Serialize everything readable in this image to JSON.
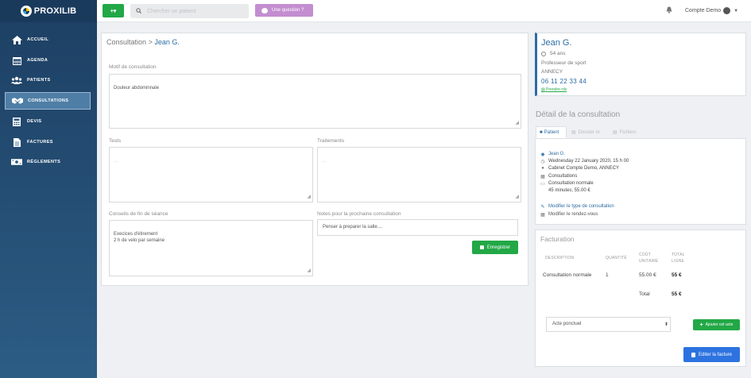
{
  "app": {
    "name": "PROXILIB"
  },
  "sidebar": {
    "items": [
      {
        "label": "ACCUEIL",
        "icon": "home-icon"
      },
      {
        "label": "AGENDA",
        "icon": "calendar-icon"
      },
      {
        "label": "PATIENTS",
        "icon": "users-icon"
      },
      {
        "label": "CONSULTATIONS",
        "icon": "handshake-icon",
        "active": true
      },
      {
        "label": "DEVIS",
        "icon": "calculator-icon"
      },
      {
        "label": "FACTURES",
        "icon": "document-icon"
      },
      {
        "label": "RÈGLEMENTS",
        "icon": "money-icon"
      }
    ]
  },
  "topbar": {
    "add_label": "+▾",
    "search_placeholder": "Chercher un patient",
    "question_label": "Une question ?",
    "account_label": "Compte Demo"
  },
  "breadcrumb": {
    "section": "Consultation",
    "separator": ">",
    "patient": "Jean G."
  },
  "form": {
    "motif_label": "Motif de consultation",
    "motif_value": "Douleur abdominnale",
    "tests_label": "Tests",
    "tests_value": "...",
    "traitements_label": "Traitements",
    "traitements_value": "...",
    "conseils_label": "Conseils de fin de séance",
    "conseils_value": "Execices d'étirement\n2 h de velo par semaine",
    "notes_label": "Notes pour la prochaine consultation",
    "notes_value": "Penser à preparer la salle....",
    "save_label": "Enregistrer"
  },
  "patient_card": {
    "name": "Jean G.",
    "age": "54 ans",
    "profession": "Professeur de sport",
    "city": "ANNECY",
    "phone": "06 11 22 33 44",
    "rdv_link": "Prendre rdv"
  },
  "detail": {
    "title": "Détail de la consultation",
    "tabs": [
      "Patient",
      "Dossier m",
      "Fichiers"
    ],
    "lines": {
      "patient": "Jean G.",
      "date": "Wednesday 22 January 2020, 15 h 00",
      "location": "Cabinet Compte Demo, ANNECY",
      "category": "Consultations",
      "type": "Consultation normale",
      "duration_price": "45 minutes, 55.00 €"
    },
    "modify_type": "Modifier le type de consultation",
    "modify_rdv": "Modifier le rendez-vous"
  },
  "billing": {
    "title": "Facturation",
    "headers": {
      "description": "DESCRIPTION",
      "quantity": "QUANTITÉ",
      "unit_cost_1": "COÛT",
      "unit_cost_2": "UNITAIRE",
      "total_1": "TOTAL",
      "total_2": "LIGNE"
    },
    "row": {
      "description": "Consultation normale",
      "quantity": "1",
      "unit_cost": "55.00 €",
      "total": "55 €"
    },
    "total_label": "Total",
    "total_value": "55 €",
    "select_value": "Acte ponctuel",
    "add_act_label": "Ajouter cet acte",
    "invoice_label": "Editer la facture"
  },
  "colors": {
    "sidebar": "#1d3f63",
    "accent": "#2c6ca3",
    "green": "#22a846",
    "purple": "#c38ed0",
    "blue_button": "#2d73e0"
  }
}
